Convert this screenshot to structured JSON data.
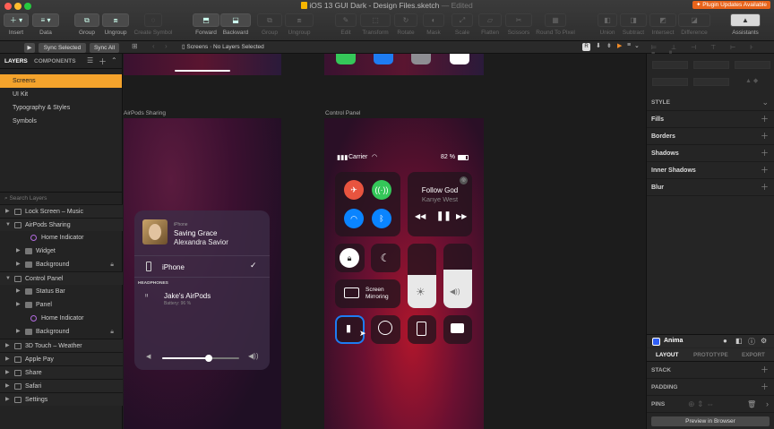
{
  "window": {
    "title": "iOS 13 GUI Dark - Design Files.sketch",
    "title_suffix": "— Edited",
    "plugin_badge": "Plugin Updates Available"
  },
  "toolbar": {
    "insert": "Insert",
    "data": "Data",
    "group": "Group",
    "ungroup": "Ungroup",
    "create_symbol": "Create Symbol",
    "forward": "Forward",
    "backward": "Backward",
    "group2": "Group",
    "ungroup2": "Ungroup",
    "edit": "Edit",
    "transform": "Transform",
    "rotate": "Rotate",
    "mask": "Mask",
    "scale": "Scale",
    "flatten": "Flatten",
    "scissors": "Scissors",
    "round_to_pixel": "Round To Pixel",
    "union": "Union",
    "subtract": "Subtract",
    "intersect": "Intersect",
    "difference": "Difference",
    "assistants": "Assistants"
  },
  "subbar": {
    "sync_selected": "Sync Selected",
    "sync_all": "Sync All",
    "breadcrumb_page": "Screens",
    "breadcrumb_selection": "No Layers Selected"
  },
  "left_panel": {
    "tabs": [
      "LAYERS",
      "COMPONENTS"
    ],
    "pages": [
      {
        "label": "Screens",
        "active": true
      },
      {
        "label": "UI Kit",
        "active": false
      },
      {
        "label": "Typography & Styles",
        "active": false
      },
      {
        "label": "Symbols",
        "active": false
      }
    ],
    "search_placeholder": "Search Layers",
    "layers": [
      {
        "label": "Lock Screen – Music",
        "kind": "group",
        "expanded": false
      },
      {
        "label": "AirPods Sharing",
        "kind": "group",
        "expanded": true
      },
      {
        "label": "Home Indicator",
        "kind": "symbol",
        "child": true
      },
      {
        "label": "Widget",
        "kind": "folder",
        "child": true
      },
      {
        "label": "Background",
        "kind": "folder",
        "child": true,
        "locked": true
      },
      {
        "label": "Control Panel",
        "kind": "group",
        "expanded": true
      },
      {
        "label": "Status Bar",
        "kind": "folder",
        "child": true
      },
      {
        "label": "Panel",
        "kind": "folder",
        "child": true
      },
      {
        "label": "Home Indicator",
        "kind": "symbol",
        "child": true
      },
      {
        "label": "Background",
        "kind": "folder",
        "child": true,
        "locked": true
      },
      {
        "label": "3D Touch – Weather",
        "kind": "group",
        "expanded": false
      },
      {
        "label": "Apple Pay",
        "kind": "group",
        "expanded": false
      },
      {
        "label": "Share",
        "kind": "group",
        "expanded": false
      },
      {
        "label": "Safari",
        "kind": "group",
        "expanded": false
      },
      {
        "label": "Settings",
        "kind": "group",
        "expanded": false
      }
    ]
  },
  "canvas": {
    "artboard_airpods": "AirPods Sharing",
    "artboard_control": "Control Panel",
    "airpods_card": {
      "source": "iPhone",
      "song": "Saving Grace",
      "artist": "Alexandra Savior",
      "device": "iPhone",
      "section": "HEADPHONES",
      "headphones": "Jake's AirPods",
      "battery": "Battery: 96 %",
      "volume": 0.6
    },
    "control_center": {
      "carrier": "Carrier",
      "battery": "82 %",
      "now_playing_title": "Follow God",
      "now_playing_artist": "Kanye West",
      "screen_mirroring": "Screen\nMirroring",
      "brightness": 0.52,
      "volume": 0.6
    }
  },
  "right_panel": {
    "style": "STYLE",
    "fills": "Fills",
    "borders": "Borders",
    "shadows": "Shadows",
    "inner_shadows": "Inner Shadows",
    "blur": "Blur",
    "anima": "Anima",
    "anima_tabs": [
      "LAYOUT",
      "PROTOTYPE",
      "EXPORT"
    ],
    "stack": "STACK",
    "padding": "PADDING",
    "pins": "PINS",
    "preview": "Preview in Browser"
  }
}
